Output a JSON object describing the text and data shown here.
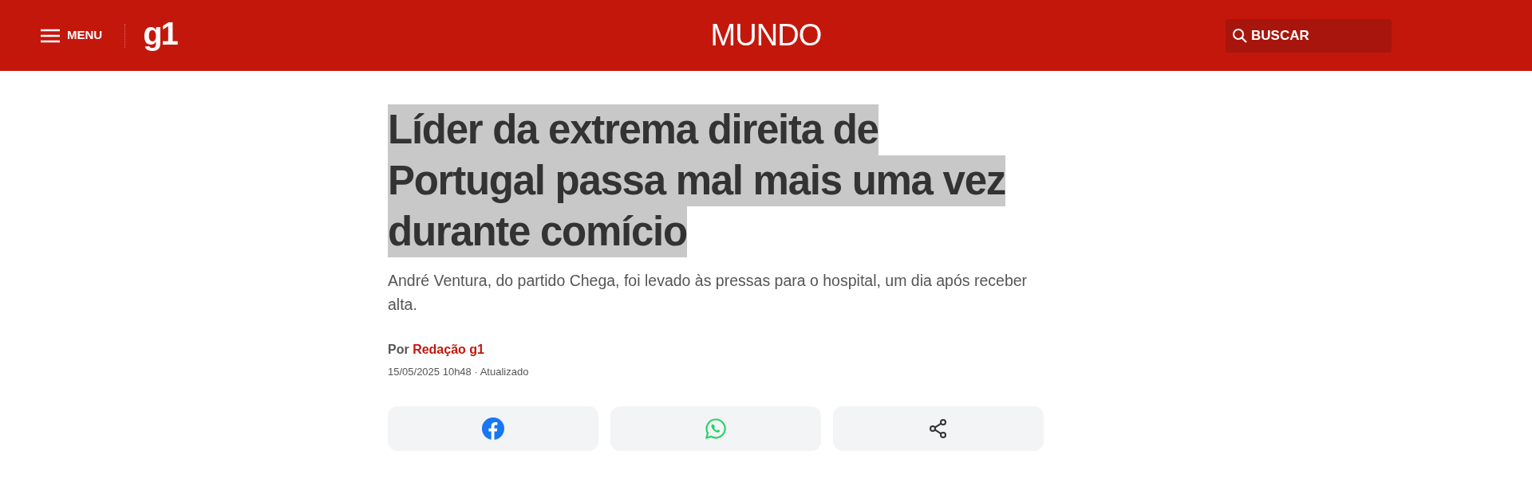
{
  "header": {
    "menu_label": "MENU",
    "logo": "g1",
    "section": "MUNDO",
    "search_label": "BUSCAR"
  },
  "article": {
    "headline_lines": [
      "Líder da extrema direita de",
      "Portugal passa mal mais uma vez",
      "durante comício"
    ],
    "headline_selected": true,
    "subtitle": "André Ventura, do partido Chega, foi levado às pressas para o hospital, um dia após receber alta.",
    "byline_prefix": "Por",
    "author": "Redação g1",
    "timestamp": "15/05/2025 10h48 · Atualizado"
  },
  "share_buttons": [
    {
      "kind": "facebook"
    },
    {
      "kind": "whatsapp"
    },
    {
      "kind": "share"
    }
  ]
}
